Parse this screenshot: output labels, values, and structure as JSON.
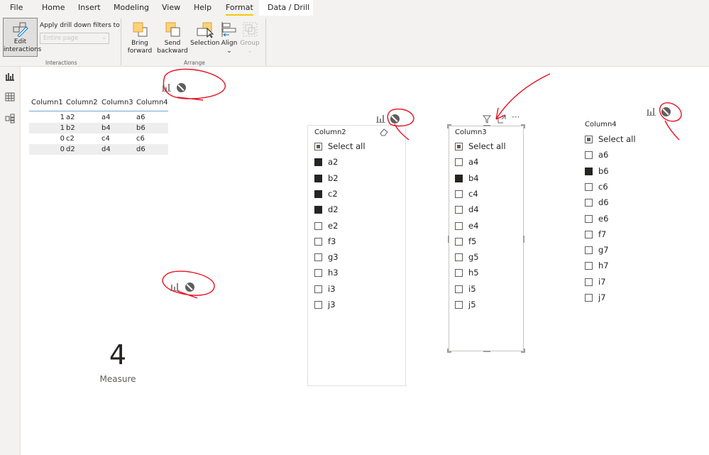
{
  "tabs": [
    "File",
    "Home",
    "Insert",
    "Modeling",
    "View",
    "Help",
    "Format",
    "Data / Drill"
  ],
  "active_tab": "Format",
  "ribbon": {
    "edit_interactions": "Edit interactions",
    "apply_drill_label": "Apply drill down filters to",
    "apply_drill_placeholder": "Entire page",
    "interactions_group": "Interactions",
    "bring_forward": "Bring forward",
    "send_backward": "Send backward",
    "selection": "Selection",
    "align": "Align",
    "group": "Group",
    "arrange_group": "Arrange"
  },
  "sidebar": [
    "report-view-icon",
    "data-view-icon",
    "model-view-icon"
  ],
  "table": {
    "headers": [
      "Column1",
      "Column2",
      "Column3",
      "Column4"
    ],
    "rows": [
      [
        "1",
        "a2",
        "a4",
        "a6"
      ],
      [
        "1",
        "b2",
        "b4",
        "b6"
      ],
      [
        "0",
        "c2",
        "c4",
        "c6"
      ],
      [
        "0",
        "d2",
        "d4",
        "d6"
      ]
    ]
  },
  "slicers": [
    {
      "title": "Column2",
      "items": [
        {
          "label": "Select all",
          "state": "partial"
        },
        {
          "label": "a2",
          "state": "on"
        },
        {
          "label": "b2",
          "state": "on"
        },
        {
          "label": "c2",
          "state": "on"
        },
        {
          "label": "d2",
          "state": "on"
        },
        {
          "label": "e2",
          "state": "off"
        },
        {
          "label": "f3",
          "state": "off"
        },
        {
          "label": "g3",
          "state": "off"
        },
        {
          "label": "h3",
          "state": "off"
        },
        {
          "label": "i3",
          "state": "off"
        },
        {
          "label": "j3",
          "state": "off"
        }
      ]
    },
    {
      "title": "Column3",
      "items": [
        {
          "label": "Select all",
          "state": "partial"
        },
        {
          "label": "a4",
          "state": "off"
        },
        {
          "label": "b4",
          "state": "on"
        },
        {
          "label": "c4",
          "state": "off"
        },
        {
          "label": "d4",
          "state": "off"
        },
        {
          "label": "e4",
          "state": "off"
        },
        {
          "label": "f5",
          "state": "off"
        },
        {
          "label": "g5",
          "state": "off"
        },
        {
          "label": "h5",
          "state": "off"
        },
        {
          "label": "i5",
          "state": "off"
        },
        {
          "label": "j5",
          "state": "off"
        }
      ]
    },
    {
      "title": "Column4",
      "items": [
        {
          "label": "Select all",
          "state": "partial"
        },
        {
          "label": "a6",
          "state": "off"
        },
        {
          "label": "b6",
          "state": "on"
        },
        {
          "label": "c6",
          "state": "off"
        },
        {
          "label": "d6",
          "state": "off"
        },
        {
          "label": "e6",
          "state": "off"
        },
        {
          "label": "f7",
          "state": "off"
        },
        {
          "label": "g7",
          "state": "off"
        },
        {
          "label": "h7",
          "state": "off"
        },
        {
          "label": "i7",
          "state": "off"
        },
        {
          "label": "j7",
          "state": "off"
        }
      ]
    }
  ],
  "card": {
    "value": "4",
    "label": "Measure"
  },
  "colors": {
    "accent": "#f2c811",
    "annotation": "#e81123",
    "selected": "#252423"
  }
}
